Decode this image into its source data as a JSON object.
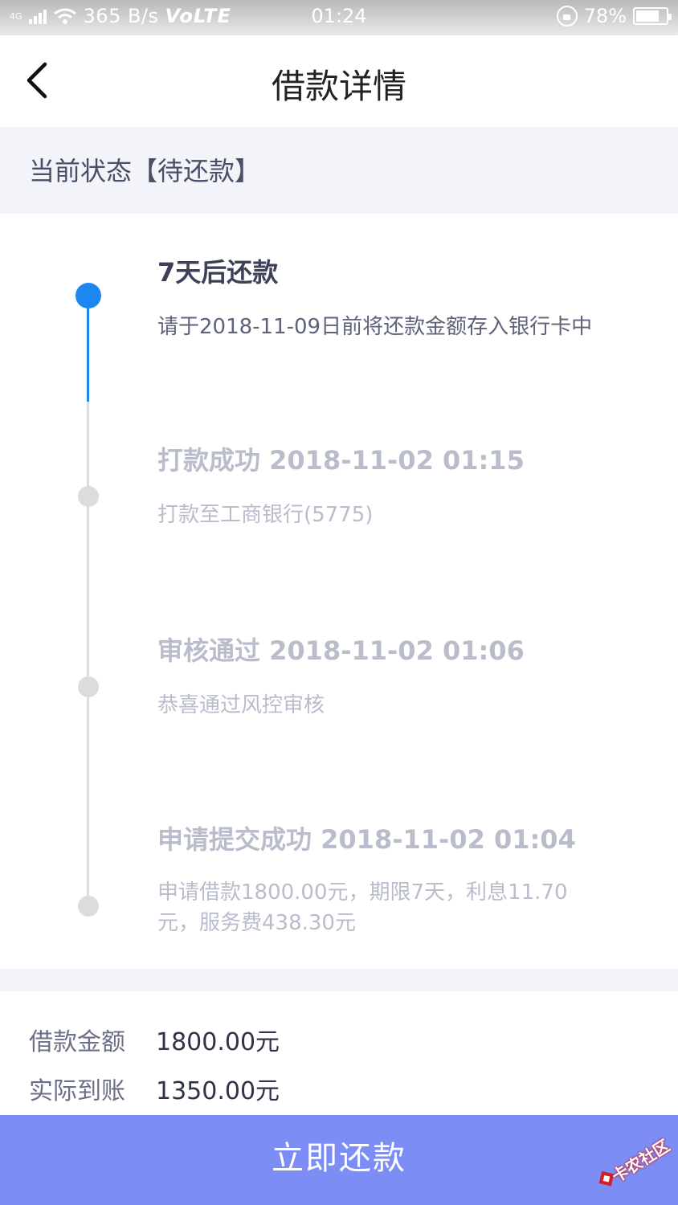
{
  "status_bar": {
    "network_tag": "4G",
    "speed": "365 B/s",
    "volte": "VoLTE",
    "time": "01:24",
    "battery": "78%",
    "battery_level": 0.78
  },
  "header": {
    "title": "借款详情",
    "back_icon": "chevron-left-icon"
  },
  "status": {
    "text": "当前状态【待还款】"
  },
  "timeline": {
    "items": [
      {
        "title": "7天后还款",
        "desc": "请于2018-11-09日前将还款金额存入银行卡中",
        "active": true
      },
      {
        "title": "打款成功 2018-11-02 01:15",
        "desc": "打款至工商银行(5775)",
        "active": false
      },
      {
        "title": "审核通过 2018-11-02 01:06",
        "desc": "恭喜通过风控审核",
        "active": false
      },
      {
        "title": "申请提交成功 2018-11-02 01:04",
        "desc": "申请借款1800.00元，期限7天，利息11.70元，服务费438.30元",
        "active": false
      }
    ]
  },
  "summary": {
    "loan_amount_label": "借款金额",
    "loan_amount_value": "1800.00元",
    "received_label": "实际到账",
    "received_value": "1350.00元"
  },
  "repay_button": {
    "label": "立即还款"
  },
  "watermark": {
    "text": "卡农社区"
  },
  "colors": {
    "accent_blue": "#1d87f0",
    "button_bg": "#7c8ef6",
    "section_bg": "#f3f4f9",
    "inactive_text": "#b9bccb"
  }
}
